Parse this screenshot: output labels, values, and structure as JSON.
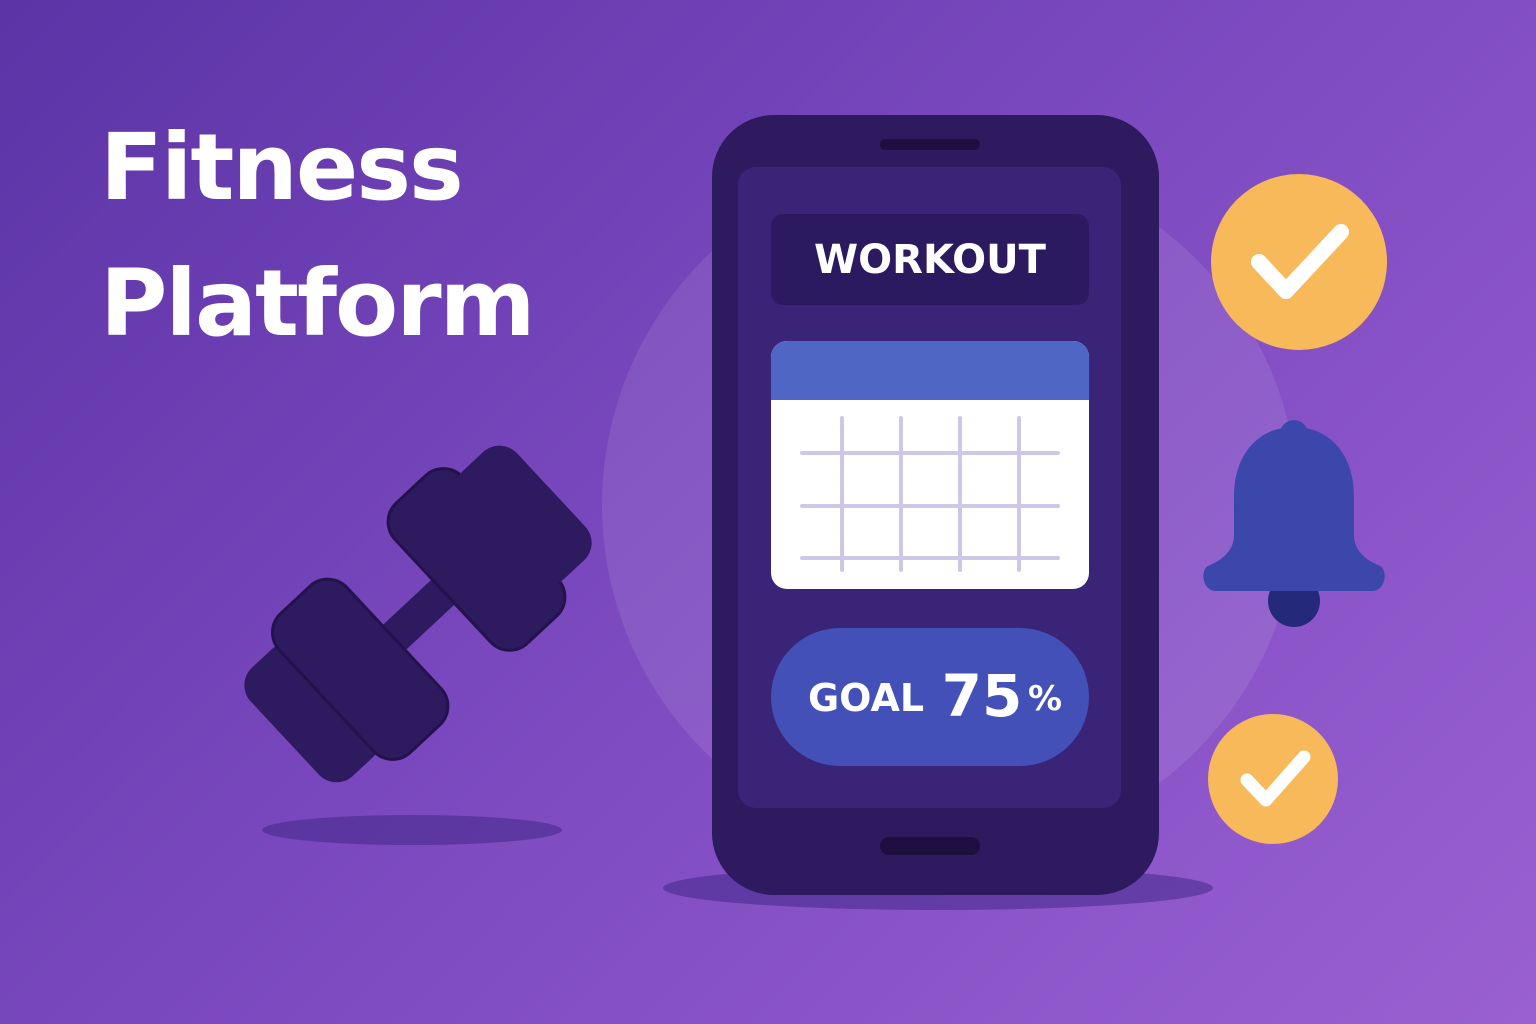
{
  "hero": {
    "title_line1": "Fitness",
    "title_line2": "Platform"
  },
  "phone": {
    "header_label": "WORKOUT",
    "goal_label": "GOAL",
    "goal_value": "75",
    "goal_unit": "%"
  },
  "icons": {
    "dumbbell": "dumbbell-icon",
    "calendar": "calendar-icon",
    "check_large": "check-circle-icon",
    "bell": "bell-icon",
    "check_small": "check-circle-icon"
  },
  "colors": {
    "background_start": "#5b34a6",
    "background_end": "#9a60d2",
    "phone_body": "#2e1a5f",
    "phone_screen": "#3a2478",
    "goal_pill": "#4350b8",
    "calendar_header": "#5066c4",
    "check_badge": "#f8b95a",
    "bell": "#3c47ac",
    "text": "#ffffff"
  }
}
